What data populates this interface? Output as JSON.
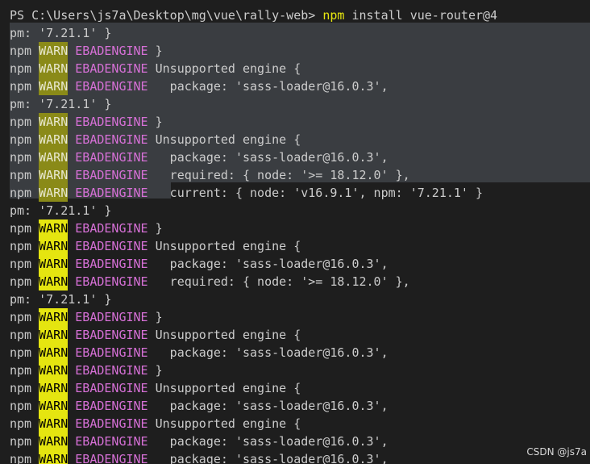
{
  "prompt": {
    "prefix": "PS C:\\Users\\js7a\\Desktop\\mg\\vue\\rally-web> ",
    "command": "npm",
    "args": " install vue-router@4"
  },
  "tokens": {
    "npm": "npm",
    "warn": "WARN",
    "ebadengine": "EBADENGINE",
    "pm_prefix": "pm:"
  },
  "lines": [
    {
      "type": "pm",
      "text": " '7.21.1' }"
    },
    {
      "type": "warn",
      "dim": true,
      "text": " }"
    },
    {
      "type": "warn",
      "dim": true,
      "text": " Unsupported engine {"
    },
    {
      "type": "warn",
      "dim": true,
      "text": "   package: 'sass-loader@16.0.3',"
    },
    {
      "type": "pm",
      "text": " '7.21.1' }"
    },
    {
      "type": "warn",
      "dim": true,
      "text": " }"
    },
    {
      "type": "warn",
      "dim": true,
      "text": " Unsupported engine {"
    },
    {
      "type": "warn",
      "dim": true,
      "text": "   package: 'sass-loader@16.0.3',"
    },
    {
      "type": "warn",
      "dim": true,
      "text": "   required: { node: '>= 18.12.0' },"
    },
    {
      "type": "warn",
      "dim": true,
      "text": "   current: { node: 'v16.9.1', npm: '7.21.1' }"
    },
    {
      "type": "pm",
      "text": " '7.21.1' }"
    },
    {
      "type": "warn",
      "dim": false,
      "text": " }"
    },
    {
      "type": "warn",
      "dim": false,
      "text": " Unsupported engine {"
    },
    {
      "type": "warn",
      "dim": false,
      "text": "   package: 'sass-loader@16.0.3',"
    },
    {
      "type": "warn",
      "dim": false,
      "text": "   required: { node: '>= 18.12.0' },"
    },
    {
      "type": "pm",
      "text": " '7.21.1' }"
    },
    {
      "type": "warn",
      "dim": false,
      "text": " }"
    },
    {
      "type": "warn",
      "dim": false,
      "text": " Unsupported engine {"
    },
    {
      "type": "warn",
      "dim": false,
      "text": "   package: 'sass-loader@16.0.3',"
    },
    {
      "type": "warn",
      "dim": false,
      "text": " }"
    },
    {
      "type": "warn",
      "dim": false,
      "text": " Unsupported engine {"
    },
    {
      "type": "warn",
      "dim": false,
      "text": "   package: 'sass-loader@16.0.3',"
    },
    {
      "type": "warn",
      "dim": false,
      "text": " Unsupported engine {"
    },
    {
      "type": "warn",
      "dim": false,
      "text": "   package: 'sass-loader@16.0.3',"
    },
    {
      "type": "warn",
      "dim": false,
      "text": "   package: 'sass-loader@16.0.3',"
    }
  ],
  "watermark": "CSDN @js7a",
  "colors": {
    "background": "#1e1e1e",
    "selection": "#3a3d41",
    "warn_bg": "#e5e510",
    "warn_bg_selected": "#8a8a18",
    "magenta": "#d670d6",
    "command_yellow": "#e5e510"
  }
}
